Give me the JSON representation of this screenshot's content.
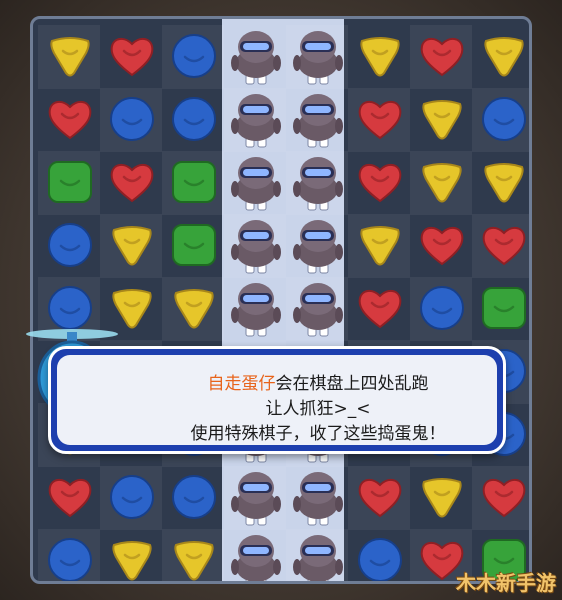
{
  "dialog": {
    "line1_highlight": "自走蛋仔",
    "line1_rest": "会在棋盘上四处乱跑",
    "line2": "让人抓狂>_<",
    "line3": "使用特殊棋子，收了这些捣蛋鬼！"
  },
  "watermark": "木木新手游",
  "colors": {
    "red": "#d63a3f",
    "blue": "#2b63c9",
    "yellow": "#e6c62a",
    "green": "#37a33a",
    "highlight_text": "#e8641b",
    "dialog_border": "#1d3fae"
  },
  "board": {
    "rows": [
      [
        "yellow-triangle",
        "red-heart",
        "blue-circle",
        "robot",
        "robot",
        "yellow-triangle",
        "red-heart",
        "yellow-triangle"
      ],
      [
        "red-heart",
        "blue-circle",
        "blue-circle",
        "robot",
        "robot",
        "red-heart",
        "yellow-triangle",
        "blue-circle"
      ],
      [
        "green-square",
        "red-heart",
        "green-square",
        "robot",
        "robot",
        "red-heart",
        "yellow-triangle",
        "yellow-triangle"
      ],
      [
        "blue-circle",
        "yellow-triangle",
        "green-square",
        "robot",
        "robot",
        "yellow-triangle",
        "red-heart",
        "red-heart"
      ],
      [
        "blue-circle",
        "yellow-triangle",
        "yellow-triangle",
        "robot",
        "robot",
        "red-heart",
        "blue-circle",
        "green-square"
      ],
      [
        "blue-circle",
        "blue-circle",
        "red-heart",
        "robot",
        "robot",
        "blue-circle",
        "blue-circle",
        "blue-circle"
      ],
      [
        "yellow-triangle",
        "red-heart",
        "blue-circle",
        "robot",
        "robot",
        "red-heart",
        "blue-circle",
        "blue-circle"
      ],
      [
        "red-heart",
        "blue-circle",
        "blue-circle",
        "robot",
        "robot",
        "red-heart",
        "yellow-triangle",
        "red-heart"
      ],
      [
        "blue-circle",
        "yellow-triangle",
        "yellow-triangle",
        "robot",
        "robot",
        "blue-circle",
        "red-heart",
        "green-square"
      ]
    ]
  }
}
